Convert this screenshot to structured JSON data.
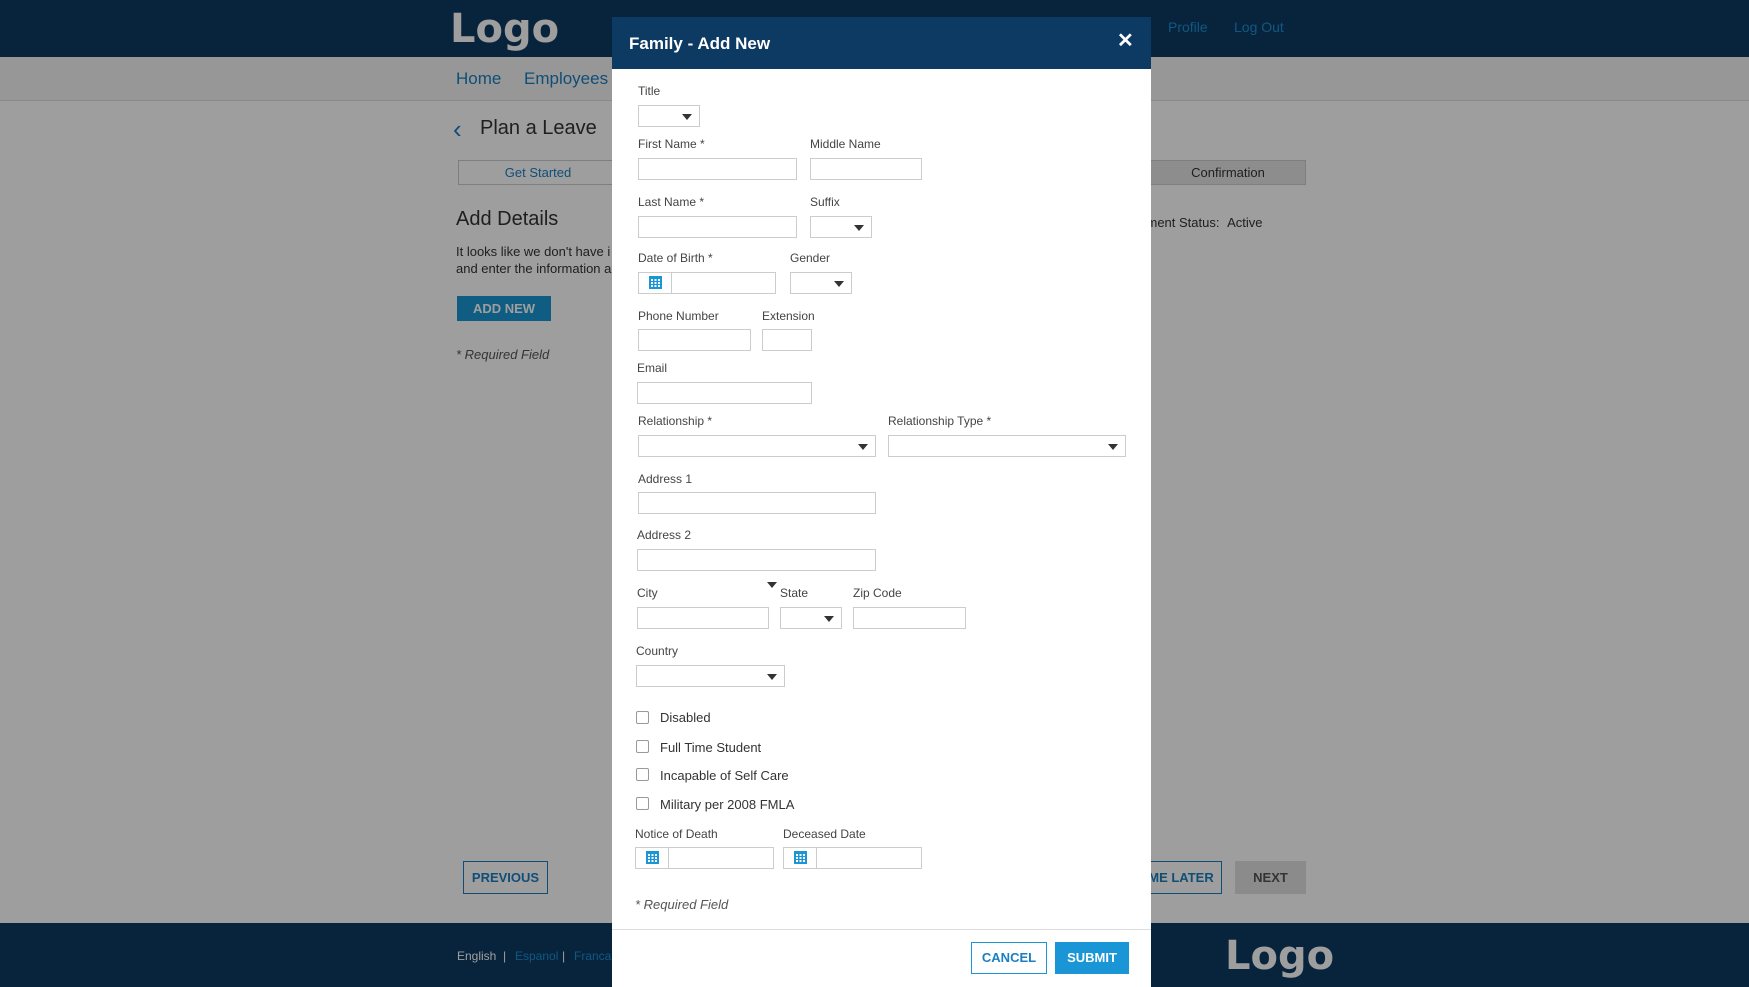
{
  "header": {
    "logo": "Logo",
    "links": {
      "profile": "Profile",
      "logout": "Log Out"
    }
  },
  "nav": {
    "home": "Home",
    "employees": "Employees"
  },
  "page": {
    "back_icon": "chevron-left-icon",
    "title": "Plan a Leave",
    "steps": {
      "get_started": "Get Started",
      "confirmation": "Confirmation"
    },
    "section_title": "Add Details",
    "intro_line1": "It looks like we don't have i",
    "intro_line2": "and enter the information a",
    "add_new": "ADD NEW",
    "required_note": "* Required Field",
    "employment_status_label": "yment Status:",
    "employment_status_value": "Active",
    "previous": "PREVIOUS",
    "finish_later": "ME LATER",
    "next": "NEXT"
  },
  "footer": {
    "languages": [
      "English",
      "Espanol",
      "Franca"
    ],
    "separator": "|",
    "logo": "Logo"
  },
  "colors": {
    "navy": "#0d3a62",
    "accent": "#1a96d6",
    "link": "#1b7fc1"
  },
  "modal": {
    "title": "Family - Add New",
    "close_icon": "close-icon",
    "fields": {
      "title": "Title",
      "first_name": "First Name *",
      "middle_name": "Middle Name",
      "last_name": "Last Name *",
      "suffix": "Suffix",
      "dob": "Date of Birth *",
      "gender": "Gender",
      "phone": "Phone Number",
      "extension": "Extension",
      "email": "Email",
      "relationship": "Relationship *",
      "relationship_type": "Relationship Type *",
      "address1": "Address 1",
      "address2": "Address 2",
      "city": "City",
      "state": "State",
      "zip": "Zip Code",
      "country": "Country",
      "notice_of_death": "Notice of Death",
      "deceased_date": "Deceased Date"
    },
    "checkboxes": [
      "Disabled",
      "Full Time Student",
      "Incapable of Self Care",
      "Military per 2008 FMLA"
    ],
    "required_note": "* Required Field",
    "cancel": "CANCEL",
    "submit": "SUBMIT"
  }
}
